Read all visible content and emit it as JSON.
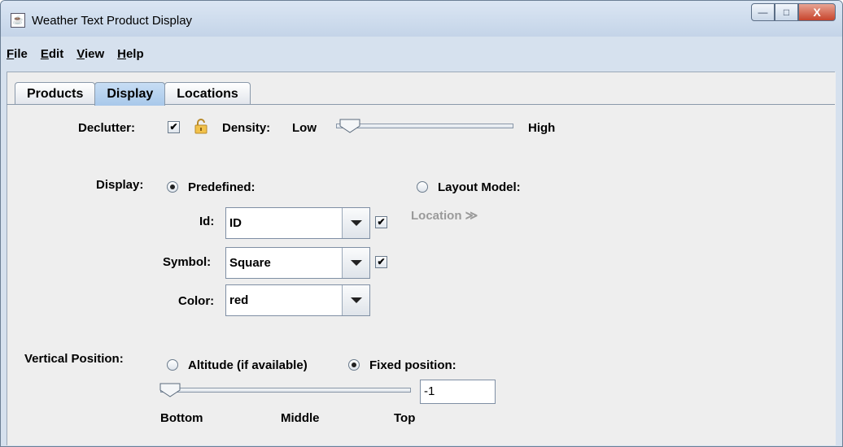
{
  "window": {
    "title": "Weather Text Product Display",
    "buttons": {
      "minimize": "—",
      "maximize": "□",
      "close": "X"
    }
  },
  "menubar": [
    {
      "label": "File",
      "mnemonic": "F",
      "rest": "ile"
    },
    {
      "label": "Edit",
      "mnemonic": "E",
      "rest": "dit"
    },
    {
      "label": "View",
      "mnemonic": "V",
      "rest": "iew"
    },
    {
      "label": "Help",
      "mnemonic": "H",
      "rest": "elp"
    }
  ],
  "tabs": [
    {
      "label": "Products"
    },
    {
      "label": "Display",
      "active": true
    },
    {
      "label": "Locations"
    }
  ],
  "declutter": {
    "label": "Declutter:",
    "checked": true,
    "check_mark": "✔",
    "lock_icon": "lock-icon"
  },
  "density": {
    "label": "Density:",
    "low": "Low",
    "high": "High",
    "value": 0.0
  },
  "display": {
    "label": "Display:",
    "predefined_label": "Predefined:",
    "predefined_selected": true,
    "layout_model_label": "Layout Model:",
    "layout_model_selected": false,
    "layout_model_value": "Location ≫"
  },
  "fields": {
    "id": {
      "label": "Id:",
      "value": "ID",
      "checked": true
    },
    "symbol": {
      "label": "Symbol:",
      "value": "Square",
      "checked": true
    },
    "color": {
      "label": "Color:",
      "value": "red"
    }
  },
  "vertical": {
    "label": "Vertical Position:",
    "altitude_label": "Altitude (if available)",
    "altitude_selected": false,
    "fixed_label": "Fixed position:",
    "fixed_selected": true,
    "fixed_value": "-1",
    "slider_value": 0.0,
    "bottom": "Bottom",
    "middle": "Middle",
    "top": "Top"
  }
}
